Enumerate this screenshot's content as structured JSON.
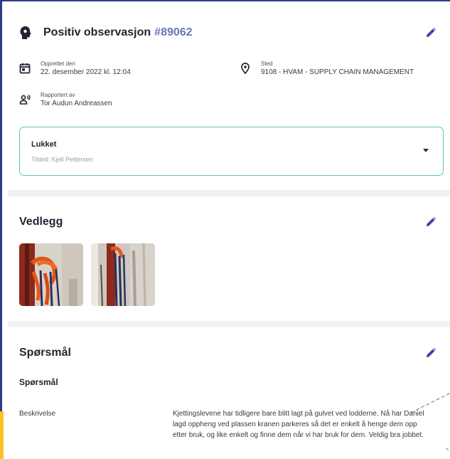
{
  "observation": {
    "title": "Positiv observasjon",
    "number": "#89062",
    "created_label": "Opprettet den",
    "created_value": "22. desember 2022 kl. 12:04",
    "place_label": "Sted",
    "place_value": "9108 - HVAM - SUPPLY CHAIN MANAGEMENT",
    "reporter_label": "Rapportert av",
    "reporter_value": "Tor Audun Andreassen"
  },
  "status": {
    "value": "Lukket",
    "assigned": "Tildelt: Kjell Pettersen"
  },
  "attachments": {
    "title": "Vedlegg"
  },
  "questions": {
    "title": "Spørsmål",
    "subtitle": "Spørsmål",
    "description_label": "Beskrivelse",
    "description_text": "Kjettingslevene har tidligere bare blitt lagt på gulvet ved lodderne. Nå har Daniel lagd oppheng ved plassen kranen parkeres så det er enkelt å henge dem opp etter bruk, og like enkelt og finne dem når vi har bruk for dem. Veldig bra jobbet."
  },
  "colors": {
    "accent": "#2f3a8f",
    "number": "#6b74b8",
    "status_border": "#5fcf8e",
    "highlight": "#f7c52a"
  }
}
